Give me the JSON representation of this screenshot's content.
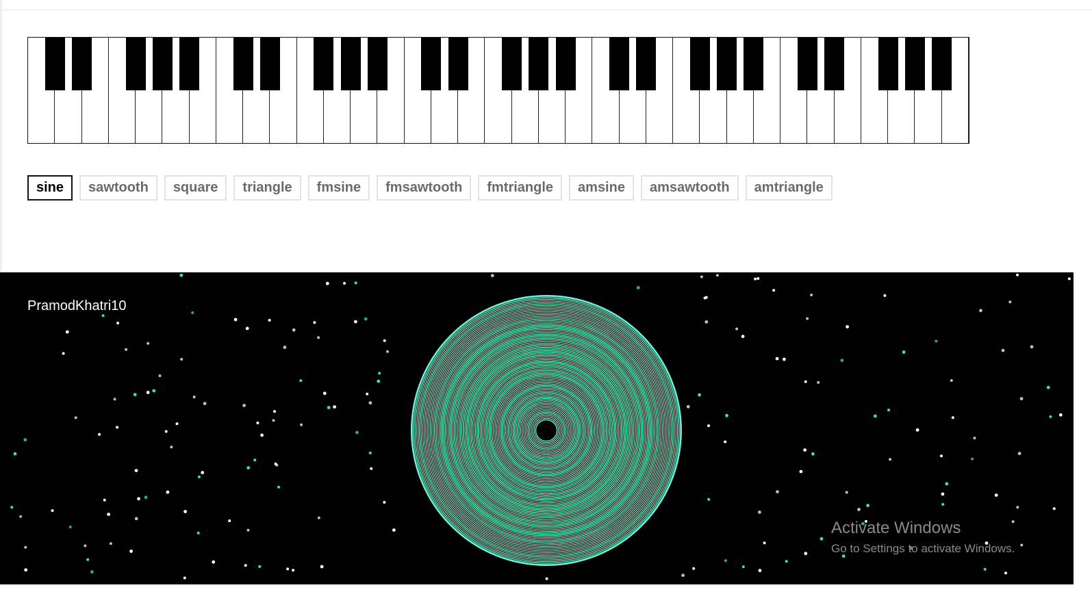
{
  "piano": {
    "white_key_count": 35,
    "black_key_pattern": [
      1,
      1,
      0,
      1,
      1,
      1,
      0
    ],
    "white_color": "#ffffff",
    "black_color": "#000000"
  },
  "waveforms": {
    "selected": "sine",
    "options": [
      "sine",
      "sawtooth",
      "square",
      "triangle",
      "fmsine",
      "fmsawtooth",
      "fmtriangle",
      "amsine",
      "amsawtooth",
      "amtriangle"
    ]
  },
  "visualizer": {
    "username": "PramodKhatri10",
    "background": "#000000",
    "ring_color": "#3ff0b0",
    "ring_color_light": "#b8fbe4",
    "outer_ring_color": "#7ee6e6",
    "star_colors": [
      "#ffffff",
      "#39e6b0"
    ]
  },
  "watermark": {
    "title": "Activate Windows",
    "subtitle": "Go to Settings to activate Windows."
  }
}
